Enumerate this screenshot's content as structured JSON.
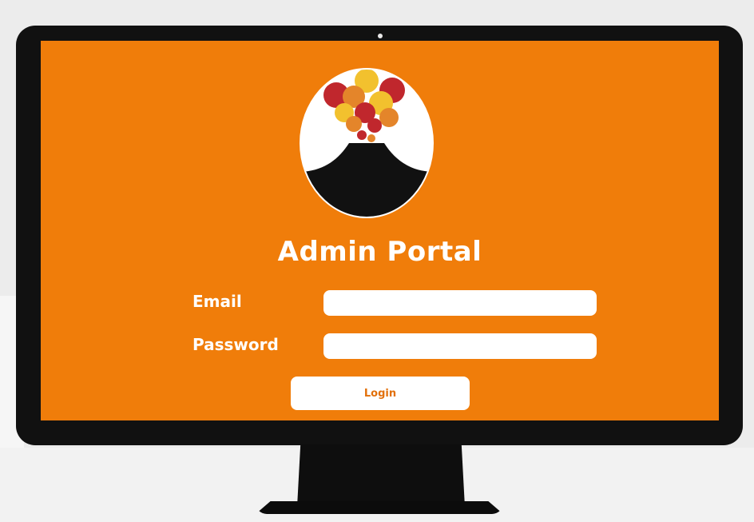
{
  "colors": {
    "screen_background": "#f07d0a",
    "monitor_bezel": "#111111",
    "text_on_screen": "#ffffff",
    "button_text": "#e2700a"
  },
  "logo": {
    "icon": "volcano-eruption-logo"
  },
  "login_form": {
    "title": "Admin Portal",
    "email_label": "Email",
    "email_value": "",
    "password_label": "Password",
    "password_value": "",
    "login_button_label": "Login"
  }
}
